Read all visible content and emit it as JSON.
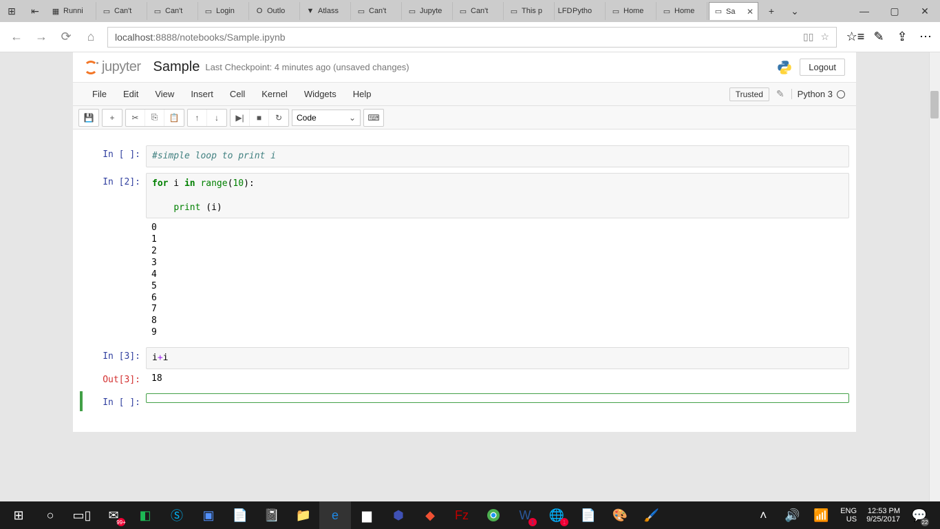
{
  "browser": {
    "tabs": [
      {
        "fav": "▦",
        "label": "Runni"
      },
      {
        "fav": "▭",
        "label": "Can't"
      },
      {
        "fav": "▭",
        "label": "Can't"
      },
      {
        "fav": "▭",
        "label": "Login"
      },
      {
        "fav": "O",
        "label": "Outlo"
      },
      {
        "fav": "▼",
        "label": "Atlass"
      },
      {
        "fav": "▭",
        "label": "Can't"
      },
      {
        "fav": "▭",
        "label": "Jupyte"
      },
      {
        "fav": "▭",
        "label": "Can't"
      },
      {
        "fav": "▭",
        "label": "This p"
      },
      {
        "fav": "LFD",
        "label": "Pytho"
      },
      {
        "fav": "▭",
        "label": "Home"
      },
      {
        "fav": "▭",
        "label": "Home"
      },
      {
        "fav": "▭",
        "label": "Sa",
        "active": true
      }
    ],
    "address": {
      "host": "localhost",
      "path": ":8888/notebooks/Sample.ipynb"
    }
  },
  "jupyter": {
    "logo": "jupyter",
    "title": "Sample",
    "checkpoint": "Last Checkpoint: 4 minutes ago (unsaved changes)",
    "logout": "Logout",
    "menu": [
      "File",
      "Edit",
      "View",
      "Insert",
      "Cell",
      "Kernel",
      "Widgets",
      "Help"
    ],
    "trusted": "Trusted",
    "kernel": "Python 3",
    "cell_type": "Code"
  },
  "cells": [
    {
      "in_prompt": "In [ ]:",
      "code_html": "<span class='cmt'>#simple loop to print i</span>"
    },
    {
      "in_prompt": "In [2]:",
      "code_html": "<span class='kw'>for</span> i <span class='kw'>in</span> <span class='bn'>range</span>(<span class='num'>10</span>):\n\n    <span class='bn'>print</span> (i)",
      "output": "0\n1\n2\n3\n4\n5\n6\n7\n8\n9"
    },
    {
      "in_prompt": "In [3]:",
      "code_html": "i<span class='op'>+</span>i",
      "out_prompt": "Out[3]:",
      "out_val": "18"
    },
    {
      "in_prompt": "In [ ]:",
      "code_html": "",
      "active": true
    }
  ],
  "taskbar": {
    "lang": "ENG",
    "region": "US",
    "time": "12:53 PM",
    "date": "9/25/2017",
    "notif": "22",
    "mail": "99+"
  }
}
